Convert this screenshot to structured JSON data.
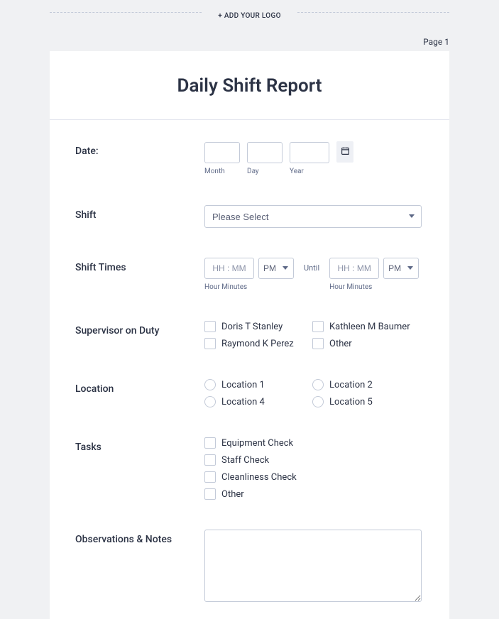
{
  "logo_placeholder": "+ ADD YOUR LOGO",
  "page_label": "Page 1",
  "title": "Daily Shift Report",
  "date": {
    "label": "Date:",
    "month_sub": "Month",
    "day_sub": "Day",
    "year_sub": "Year"
  },
  "shift": {
    "label": "Shift",
    "placeholder": "Please Select"
  },
  "shift_times": {
    "label": "Shift Times",
    "time_placeholder": "HH : MM",
    "ampm": "PM",
    "until": "Until",
    "sub": "Hour Minutes"
  },
  "supervisor": {
    "label": "Supervisor on  Duty",
    "options": [
      "Doris T Stanley",
      "Kathleen M Baumer",
      "Raymond K Perez",
      "Other"
    ]
  },
  "location": {
    "label": "Location",
    "options": [
      "Location 1",
      "Location 2",
      "Location 4",
      "Location 5"
    ]
  },
  "tasks": {
    "label": "Tasks",
    "options": [
      "Equipment Check",
      "Staff Check",
      "Cleanliness Check",
      "Other"
    ]
  },
  "notes": {
    "label": "Observations & Notes"
  }
}
